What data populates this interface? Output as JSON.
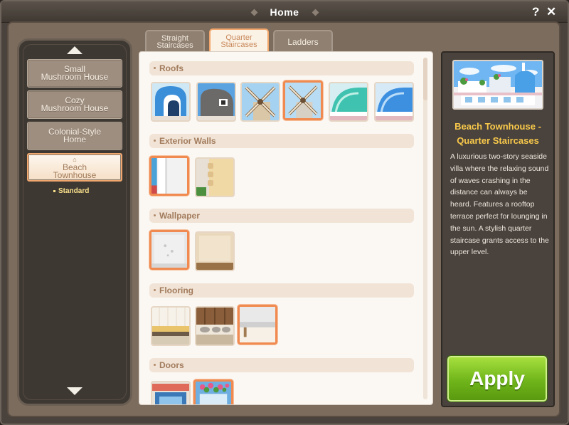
{
  "window": {
    "title": "Home",
    "help_label": "?",
    "close_label": "✕"
  },
  "houses": [
    {
      "line1": "Small",
      "line2": "Mushroom House"
    },
    {
      "line1": "Cozy",
      "line2": "Mushroom House"
    },
    {
      "line1": "Colonial-Style",
      "line2": "Home"
    },
    {
      "line1": "Beach",
      "line2": "Townhouse",
      "active": true,
      "sub": "Standard"
    }
  ],
  "tabs": [
    {
      "line1": "Straight",
      "line2": "Staircases"
    },
    {
      "line1": "Quarter",
      "line2": "Staircases",
      "active": true
    },
    {
      "label": "Ladders"
    }
  ],
  "sections": {
    "roofs": "Roofs",
    "exterior_walls": "Exterior Walls",
    "wallpaper": "Wallpaper",
    "flooring": "Flooring",
    "doors": "Doors"
  },
  "detail": {
    "title_line1": "Beach Townhouse -",
    "title_line2": "Quarter Staircases",
    "description": "A luxurious two-story seaside villa where the relaxing sound of waves crashing in the distance can always be heard. Features a rooftop terrace perfect for lounging in the sun. A stylish quarter staircase grants access to the upper level."
  },
  "apply_label": "Apply",
  "colors": {
    "accent": "#f08a50",
    "apply_green": "#7cc221",
    "detail_title": "#f8c84a"
  }
}
